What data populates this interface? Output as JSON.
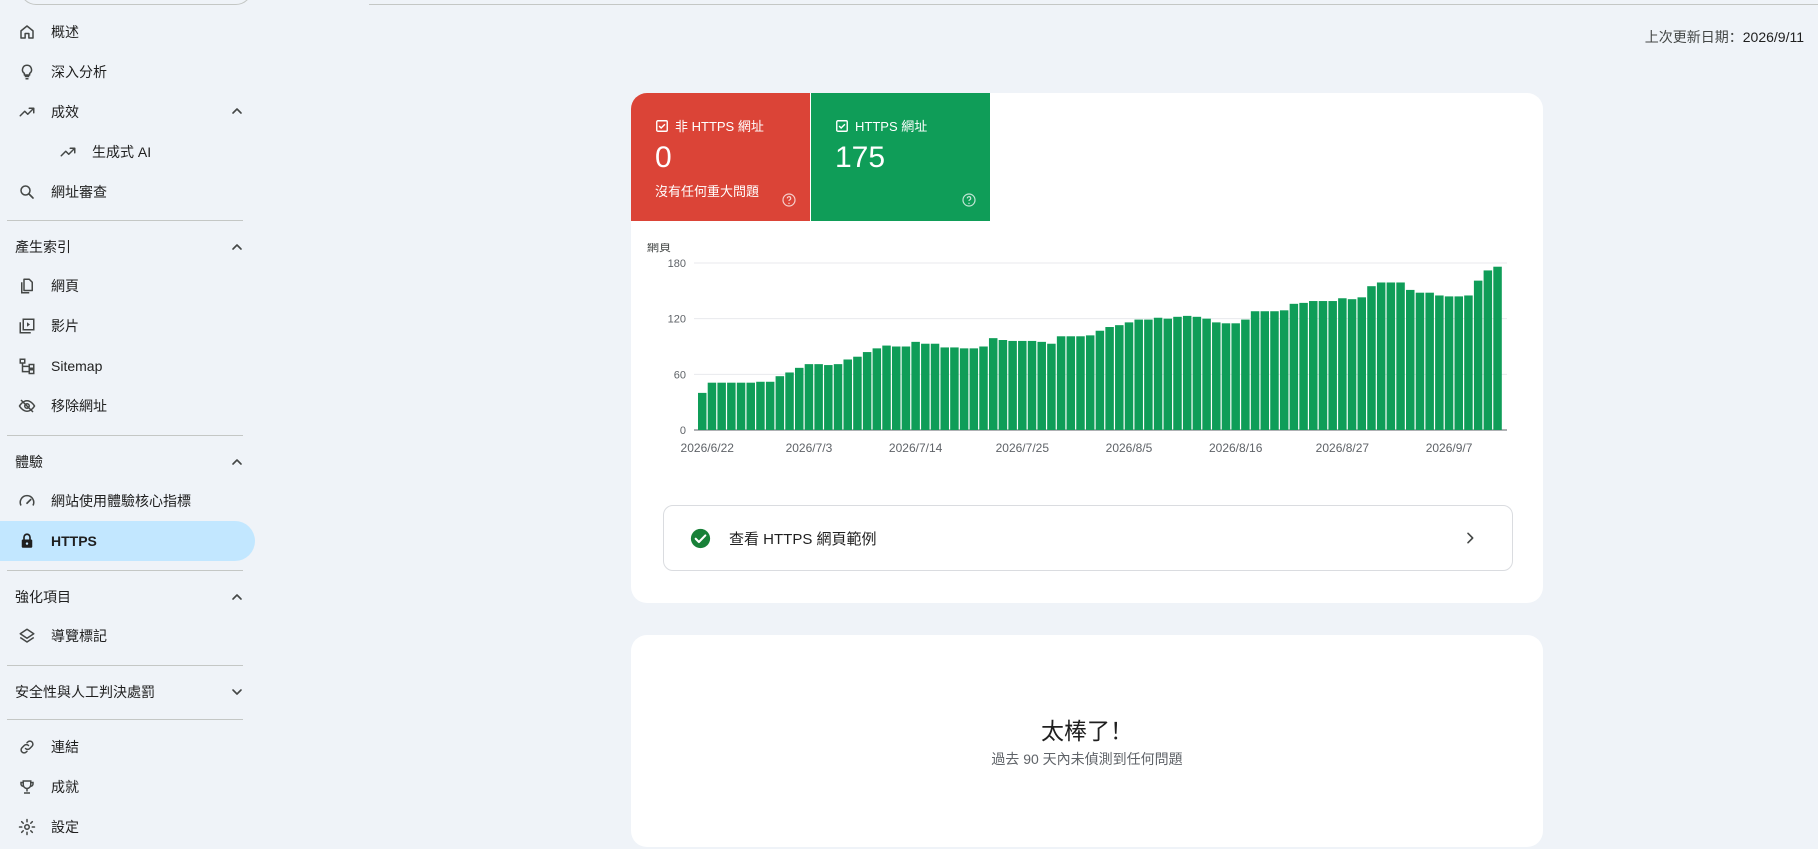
{
  "sidebar": {
    "items": [
      {
        "label": "概述",
        "icon": "home-icon"
      },
      {
        "label": "深入分析",
        "icon": "lightbulb-icon"
      },
      {
        "label": "成效",
        "icon": "trending-up-icon"
      },
      {
        "label": "生成式 AI",
        "icon": "trending-up-icon"
      },
      {
        "label": "網址審查",
        "icon": "search-icon"
      },
      {
        "label": "網頁",
        "icon": "pages-icon"
      },
      {
        "label": "影片",
        "icon": "video-library-icon"
      },
      {
        "label": "Sitemap",
        "icon": "sitemap-icon"
      },
      {
        "label": "移除網址",
        "icon": "visibility-off-icon"
      },
      {
        "label": "網站使用體驗核心指標",
        "icon": "speed-icon"
      },
      {
        "label": "HTTPS",
        "icon": "lock-icon"
      },
      {
        "label": "導覽標記",
        "icon": "layers-icon"
      },
      {
        "label": "連結",
        "icon": "link-icon"
      },
      {
        "label": "成就",
        "icon": "trophy-icon"
      },
      {
        "label": "設定",
        "icon": "gear-icon"
      }
    ],
    "sections": {
      "indexing": "產生索引",
      "experience": "體驗",
      "enhancements": "強化項目",
      "security": "安全性與人工判決處罰"
    }
  },
  "header": {
    "updated_label": "上次更新日期：",
    "updated_value": "2026/9/11"
  },
  "tiles": {
    "non_https": {
      "label": "非 HTTPS 網址",
      "value": "0",
      "desc": "沒有任何重大問題",
      "color": "#db4437"
    },
    "https": {
      "label": "HTTPS 網址",
      "value": "175",
      "color": "#0f9d58"
    }
  },
  "chart_data": {
    "type": "bar",
    "ylabel": "網頁",
    "ylim": [
      0,
      180
    ],
    "yticks": [
      "0",
      "60",
      "120",
      "180"
    ],
    "xtick_labels": [
      "2026/6/22",
      "2026/7/3",
      "2026/7/14",
      "2026/7/25",
      "2026/8/5",
      "2026/8/16",
      "2026/8/27",
      "2026/9/7"
    ],
    "series": [
      {
        "color": "#0f9d58",
        "values": [
          40,
          51,
          51,
          51,
          51,
          51,
          52,
          52,
          58,
          62,
          67,
          71,
          71,
          70,
          71,
          76,
          79,
          84,
          88,
          91,
          90,
          90,
          95,
          93,
          93,
          89,
          89,
          88,
          88,
          90,
          99,
          97,
          96,
          96,
          96,
          95,
          93,
          101,
          101,
          101,
          102,
          107,
          111,
          113,
          116,
          119,
          119,
          121,
          120,
          122,
          123,
          122,
          120,
          116,
          115,
          115,
          119,
          128,
          128,
          128,
          129,
          136,
          137,
          139,
          139,
          139,
          142,
          141,
          143,
          155,
          159,
          159,
          159,
          151,
          148,
          148,
          145,
          144,
          144,
          145,
          161,
          172,
          176
        ]
      }
    ]
  },
  "example_row": {
    "label": "查看 HTTPS 網頁範例"
  },
  "empty_state": {
    "title": "太棒了！",
    "subtitle": "過去 90 天內未偵測到任何問題"
  }
}
